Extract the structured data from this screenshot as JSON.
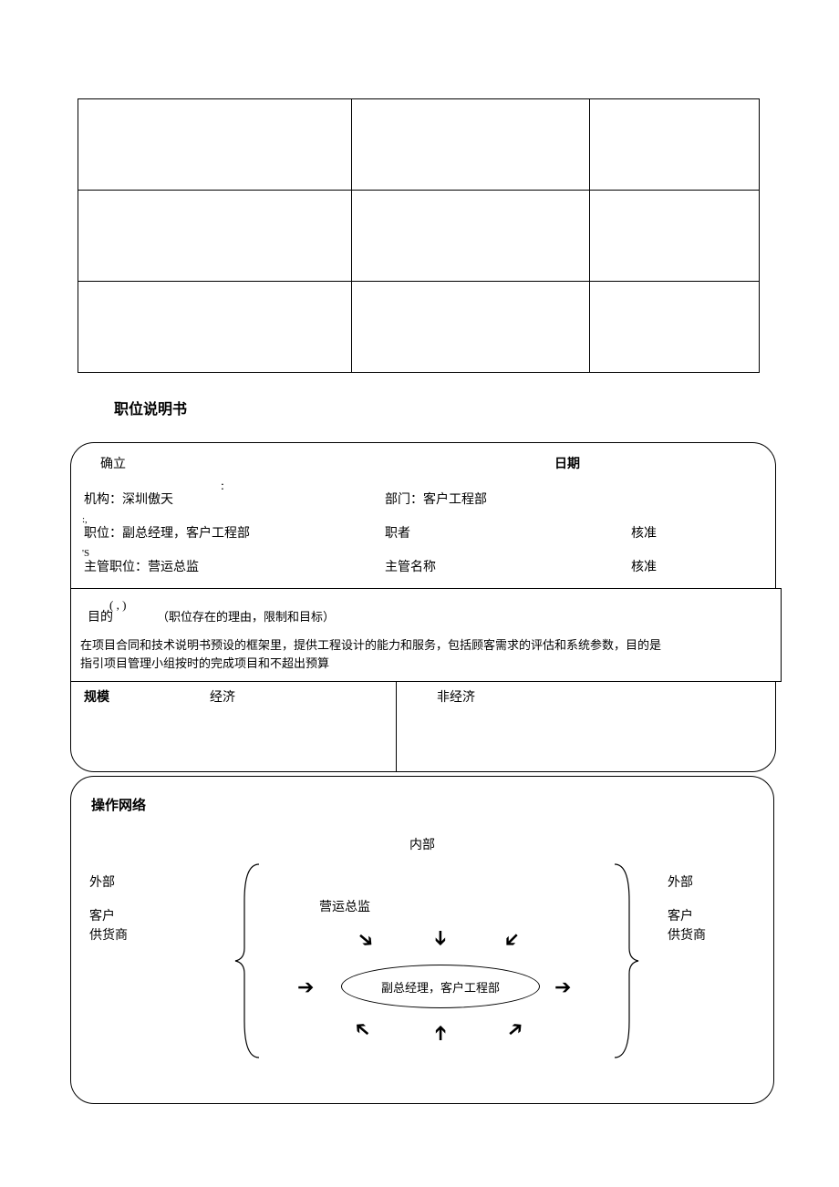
{
  "doc_title": "职位说明书",
  "header": {
    "confirm": "确立",
    "date_label": "日期",
    "colon": ":",
    "org_label": "机构：深圳傲天",
    "dept_label": "部门：客户工程部",
    "mark1": ":,",
    "position_label": "职位：副总经理，客户工程部",
    "holder_label": "职者",
    "approve1": "核准",
    "mark2": "'S",
    "supervisor_pos": "主管职位：营运总监",
    "supervisor_name": "主管名称",
    "approve2": "核准"
  },
  "purpose": {
    "paren": "(        ,               )",
    "label": "目的",
    "sub": "（职位存在的理由，限制和目标）",
    "body1": "在项目合同和技术说明书预设的框架里，提供工程设计的能力和服务，包括顾客需求的评估和系统参数，目的是",
    "body2": "指引项目管理小组按时的完成项目和不超出预算"
  },
  "scale": {
    "title": "规模",
    "economic": "经济",
    "non_economic": "非经济"
  },
  "network": {
    "title": "操作网络",
    "internal": "内部",
    "external": "外部",
    "customer": "客户",
    "supplier": "供货商",
    "manager": "营运总监",
    "center": "副总经理，客户工程部"
  }
}
